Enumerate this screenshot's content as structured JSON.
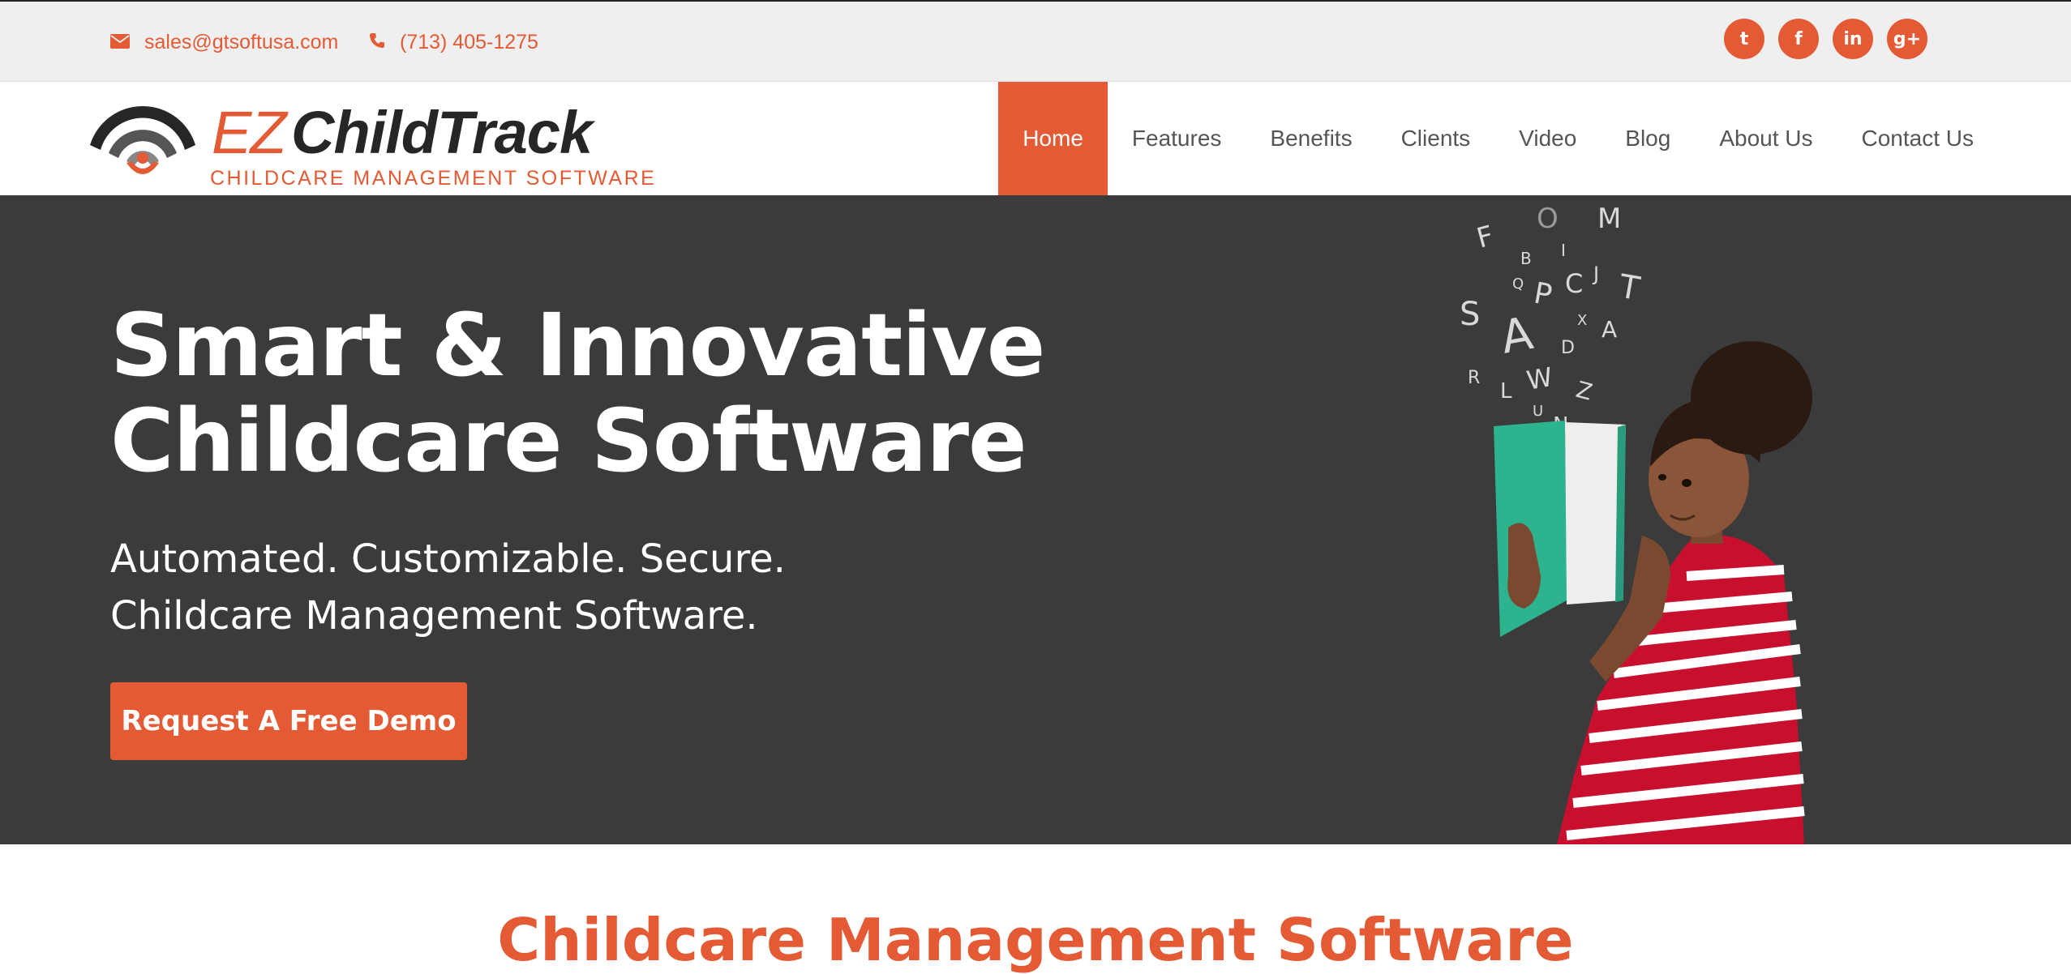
{
  "topbar": {
    "email": "sales@gtsoftusa.com",
    "phone": "(713) 405-1275",
    "social": [
      {
        "name": "twitter",
        "glyph": "t"
      },
      {
        "name": "facebook",
        "glyph": "f"
      },
      {
        "name": "linkedin",
        "glyph": "in"
      },
      {
        "name": "google-plus",
        "glyph": "g+"
      }
    ]
  },
  "logo": {
    "ez": "EZ",
    "childtrack": "ChildTrack",
    "tagline": "CHILDCARE MANAGEMENT SOFTWARE"
  },
  "nav": {
    "items": [
      "Home",
      "Features",
      "Benefits",
      "Clients",
      "Video",
      "Blog",
      "About Us",
      "Contact Us"
    ],
    "active": "Home"
  },
  "hero": {
    "title_line1": "Smart & Innovative",
    "title_line2": "Childcare Software",
    "sub_line1": "Automated. Customizable. Secure.",
    "sub_line2": "Childcare Management Software.",
    "cta": "Request A Free Demo"
  },
  "section": {
    "title": "Childcare Management Software"
  },
  "colors": {
    "accent": "#e35a34",
    "topbar_bg": "#efefef",
    "hero_bg": "#3b3b3b",
    "text_dark": "#555555"
  }
}
